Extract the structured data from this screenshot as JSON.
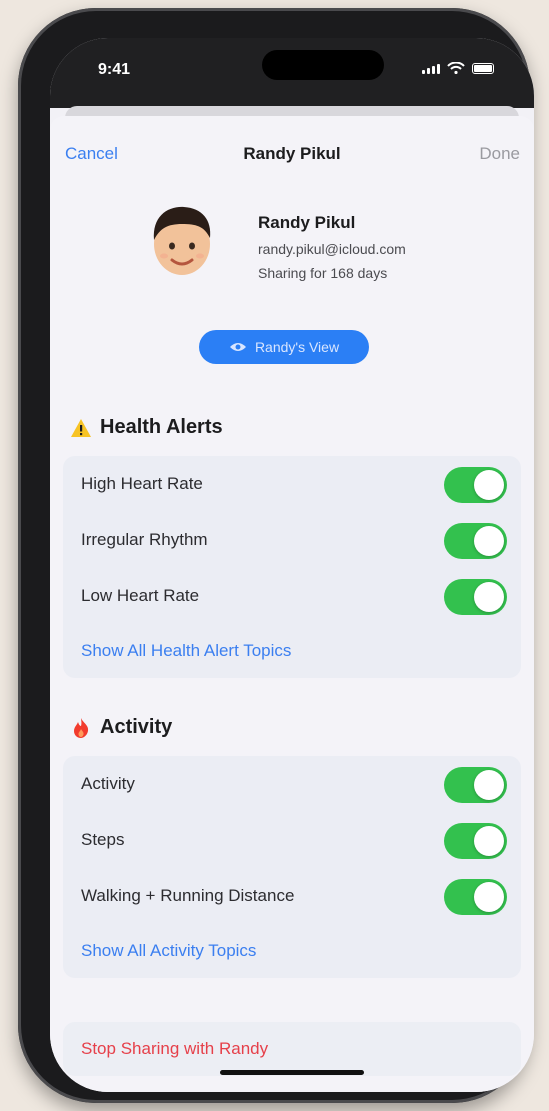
{
  "status_bar": {
    "time": "9:41"
  },
  "nav": {
    "cancel": "Cancel",
    "title": "Randy Pikul",
    "done": "Done"
  },
  "profile": {
    "name": "Randy Pikul",
    "email": "randy.pikul@icloud.com",
    "sharing": "Sharing for 168 days"
  },
  "view_button": {
    "label": "Randy's View"
  },
  "health_alerts": {
    "title": "Health Alerts",
    "rows": [
      {
        "label": "High Heart Rate",
        "on": true
      },
      {
        "label": "Irregular Rhythm",
        "on": true
      },
      {
        "label": "Low Heart Rate",
        "on": true
      }
    ],
    "link": "Show All Health Alert Topics"
  },
  "activity": {
    "title": "Activity",
    "rows": [
      {
        "label": "Activity",
        "on": true
      },
      {
        "label": "Steps",
        "on": true
      },
      {
        "label": "Walking + Running Distance",
        "on": true
      }
    ],
    "link": "Show All Activity Topics"
  },
  "stop_sharing": "Stop Sharing with Randy",
  "colors": {
    "accent": "#2b7ff5",
    "toggle_on": "#33c14e",
    "destructive": "#e6404a"
  }
}
